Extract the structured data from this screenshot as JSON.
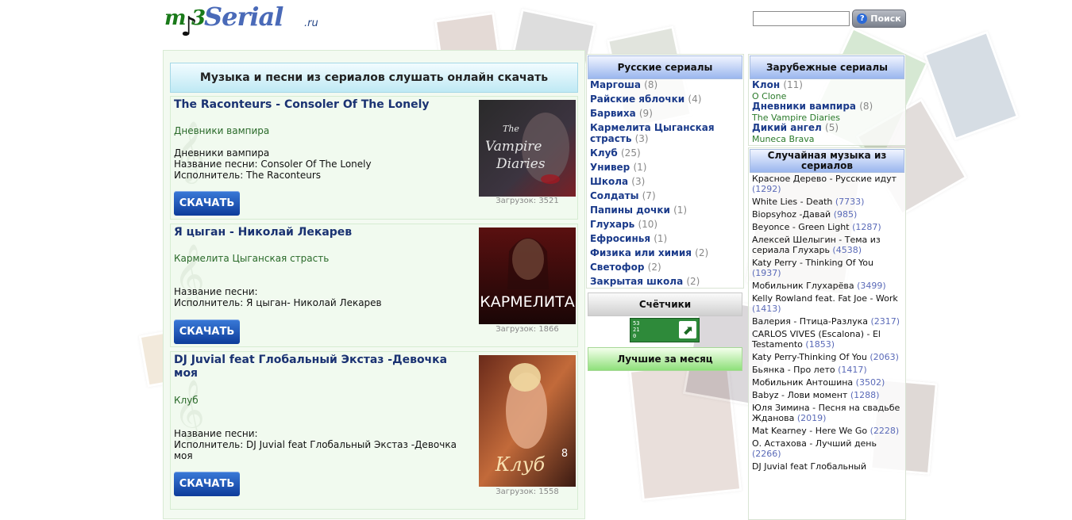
{
  "logo": {
    "m": "m",
    "num": "3",
    "serial": "Serial",
    "ru": ".ru"
  },
  "search": {
    "value": "",
    "button_label": "Поиск",
    "help_glyph": "?"
  },
  "main": {
    "heading": "Музыка и песни из сериалов слушать онлайн скачать",
    "songs": [
      {
        "title": "The Raconteurs - Consoler Of The Lonely",
        "series": "Дневники вампира",
        "info": [
          "Дневники вампира",
          "Название песни: Consoler Of The Lonely",
          "Исполнитель: The Raconteurs"
        ],
        "button": "СКАЧАТЬ",
        "downloads": "Загрузок: 3521",
        "cover_text": "The Vampire Diaries"
      },
      {
        "title": "Я цыган - Николай Лекарев",
        "series": "Кармелита Цыганская страсть",
        "info": [
          "Название песни:",
          "Исполнитель: Я цыган- Николай Лекарев"
        ],
        "button": "СКАЧАТЬ",
        "downloads": "Загрузок: 1866",
        "cover_text": "КАРМЕЛИТА"
      },
      {
        "title": "DJ Juvial feat Глобальный Экстаз -Девочка моя",
        "series": "Клуб",
        "info": [
          "Название песни:",
          "Исполнитель: DJ Juvial feat Глобальный Экстаз -Девочка моя"
        ],
        "button": "СКАЧАТЬ",
        "downloads": "Загрузок: 1558",
        "cover_text": "Клуб",
        "cover_num": "8"
      }
    ]
  },
  "russian": {
    "heading": "Русские сериалы",
    "items": [
      {
        "name": "Маргоша",
        "count": "(8)"
      },
      {
        "name": "Райские яблочки",
        "count": "(4)"
      },
      {
        "name": "Барвиха",
        "count": "(9)"
      },
      {
        "name": "Кармелита Цыганская страсть",
        "count": "(3)"
      },
      {
        "name": "Клуб",
        "count": "(25)"
      },
      {
        "name": "Универ",
        "count": "(1)"
      },
      {
        "name": "Школа",
        "count": "(3)"
      },
      {
        "name": "Солдаты",
        "count": "(7)"
      },
      {
        "name": "Папины дочки",
        "count": "(1)"
      },
      {
        "name": "Глухарь",
        "count": "(10)"
      },
      {
        "name": "Ефросинья",
        "count": "(1)"
      },
      {
        "name": "Физика или химия",
        "count": "(2)"
      },
      {
        "name": "Светофор",
        "count": "(2)"
      },
      {
        "name": "Закрытая школа",
        "count": "(2)"
      }
    ]
  },
  "counters": {
    "heading": "Счётчики",
    "digits": [
      "53",
      "21",
      "0"
    ],
    "arrow": "⬈"
  },
  "best": {
    "heading": "Лучшие за месяц"
  },
  "foreign": {
    "heading": "Зарубежные сериалы",
    "items": [
      {
        "name": "Клон",
        "count": "(11)",
        "orig": "O Clone"
      },
      {
        "name": "Дневники вампира",
        "count": "(8)",
        "orig": "The Vampire Diaries"
      },
      {
        "name": "Дикий ангел",
        "count": "(5)",
        "orig": "Muneca Brava"
      }
    ]
  },
  "random": {
    "heading": "Случайная музыка из сериалов",
    "items": [
      {
        "text": "Красное Дерево - Русские идут",
        "count": "(1292)"
      },
      {
        "text": "White Lies - Death",
        "count": "(7733)"
      },
      {
        "text": "Biopsyhoz -Давай",
        "count": "(985)"
      },
      {
        "text": "Beyonce - Green Light",
        "count": "(1287)"
      },
      {
        "text": "Алексей Шелыгин - Тема из сериала Глухарь",
        "count": "(4538)"
      },
      {
        "text": "Katy Perry - Thinking Of You",
        "count": "(1937)"
      },
      {
        "text": "Мобильник Глухарёва",
        "count": "(3499)"
      },
      {
        "text": "Kelly Rowland feat. Fat Joe - Work",
        "count": "(1413)"
      },
      {
        "text": "Валерия - Птица-Разлука",
        "count": "(2317)"
      },
      {
        "text": "CARLOS VIVES (Escalona) - El Testamento",
        "count": "(1853)"
      },
      {
        "text": "Katy Perry-Thinking Of You",
        "count": "(2063)"
      },
      {
        "text": "Бьянка - Про лето",
        "count": "(1417)"
      },
      {
        "text": "Мобильник Антошина",
        "count": "(3502)"
      },
      {
        "text": "Babyz - Лови момент",
        "count": "(1288)"
      },
      {
        "text": "Юля Зимина - Песня на свадьбе Жданова",
        "count": "(2019)"
      },
      {
        "text": "Mat Kearney - Here We Go",
        "count": "(2228)"
      },
      {
        "text": "О. Астахова - Лучший день",
        "count": "(2266)"
      },
      {
        "text": "DJ Juvial feat Глобальный",
        "count": ""
      }
    ]
  },
  "colors": {
    "link": "#1a3a8a",
    "series_green": "#2a6a2a",
    "count_blue": "#5a6ab8",
    "download_blue": "#0d3c9a"
  }
}
